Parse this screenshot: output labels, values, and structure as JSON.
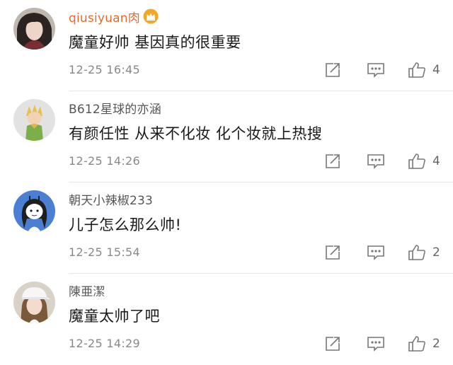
{
  "comments": [
    {
      "username": "qiusiyuan肉",
      "is_vip": true,
      "text": "魔童好帅 基因真的很重要",
      "time": "12-25 16:45",
      "likes": "4",
      "avatar_icon": "avatar-girl-long-hair"
    },
    {
      "username": "B612星球的亦涵",
      "is_vip": false,
      "text": "有颜任性 从来不化妆 化个妆就上热搜",
      "time": "12-25 14:26",
      "likes": "4",
      "avatar_icon": "avatar-little-prince-figure"
    },
    {
      "username": "朝天小辣椒233",
      "is_vip": false,
      "text": "儿子怎么那么帅!",
      "time": "12-25 15:54",
      "likes": "2",
      "avatar_icon": "avatar-cartoon-girl-braids"
    },
    {
      "username": "陳亜潔",
      "is_vip": false,
      "text": "魔童太帅了吧",
      "time": "12-25 14:29",
      "likes": "2",
      "avatar_icon": "avatar-girl-cap"
    }
  ],
  "colors": {
    "vip_name": "#e86a2b",
    "name": "#555555",
    "time": "#888888",
    "icon": "#777777",
    "divider": "#e8e8e8"
  },
  "icons": {
    "repost": "repost-icon",
    "reply": "reply-icon",
    "like": "like-icon",
    "vip": "crown-badge-icon"
  }
}
